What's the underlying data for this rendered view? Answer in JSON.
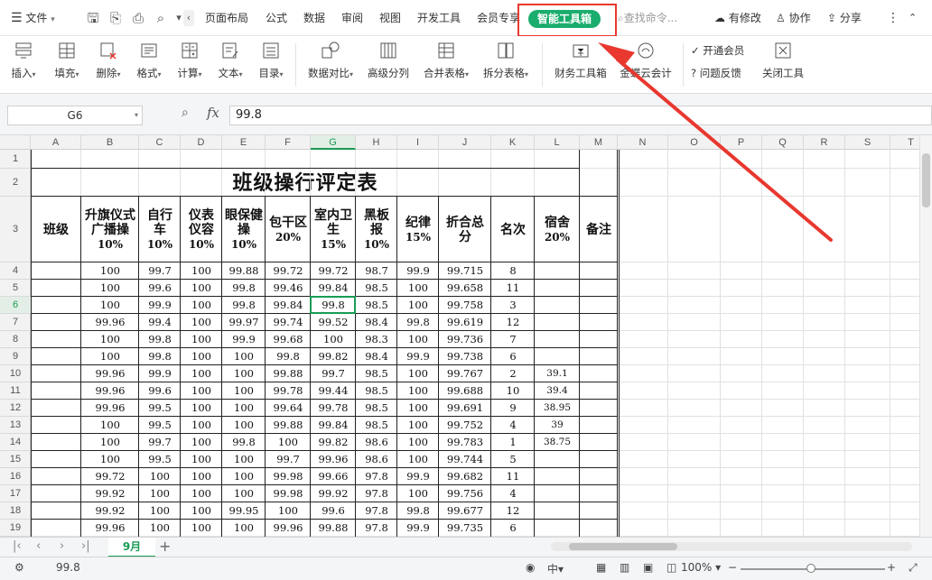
{
  "menubar": {
    "file_label": "文件",
    "tabs": [
      "页面布局",
      "公式",
      "数据",
      "审阅",
      "视图",
      "开发工具",
      "会员专享"
    ],
    "smart_toolbox": "智能工具箱",
    "search_placeholder": "查找命令...",
    "has_changes": "有修改",
    "collab": "协作",
    "share": "分享"
  },
  "ribbon": {
    "insert": "插入",
    "fill": "填充",
    "delete": "删除",
    "format": "格式",
    "calc": "计算",
    "text": "文本",
    "toc": "目录",
    "data_compare": "数据对比",
    "adv_split": "高级分列",
    "merge_tables": "合并表格",
    "split_tables": "拆分表格",
    "finance": "财务工具箱",
    "cloud_accounting": "金蝶云会计",
    "open_member": "开通会员",
    "feedback": "问题反馈",
    "close_tool": "关闭工具"
  },
  "formula_bar": {
    "cell_ref": "G6",
    "fx": "fx",
    "value": "99.8"
  },
  "columns": [
    "A",
    "B",
    "C",
    "D",
    "E",
    "F",
    "G",
    "H",
    "I",
    "J",
    "K",
    "L",
    "M",
    "N",
    "O",
    "P",
    "Q",
    "R",
    "S",
    "T"
  ],
  "rows": [
    "1",
    "2",
    "3",
    "4",
    "5",
    "6",
    "7",
    "8",
    "9",
    "10",
    "11",
    "12",
    "13",
    "14",
    "15",
    "16",
    "17",
    "18",
    "19"
  ],
  "sheet": {
    "title": "班级操行评定表",
    "headers": [
      {
        "text": "班级",
        "pct": ""
      },
      {
        "text": "升旗仪式广播操",
        "pct": "10%"
      },
      {
        "text": "自行车",
        "pct": "10%"
      },
      {
        "text": "仪表仪容",
        "pct": "10%"
      },
      {
        "text": "眼保健操",
        "pct": "10%"
      },
      {
        "text": "包干区",
        "pct": "20%"
      },
      {
        "text": "室内卫生",
        "pct": "15%"
      },
      {
        "text": "黑板报",
        "pct": "10%"
      },
      {
        "text": "纪律",
        "pct": "15%"
      },
      {
        "text": "折合总分",
        "pct": ""
      },
      {
        "text": "名次",
        "pct": ""
      },
      {
        "text": "宿舍",
        "pct": "20%"
      },
      {
        "text": "备注",
        "pct": ""
      }
    ],
    "data_rows": [
      [
        "",
        "100",
        "99.7",
        "100",
        "99.88",
        "99.72",
        "99.72",
        "98.7",
        "99.9",
        "99.715",
        "8",
        "",
        ""
      ],
      [
        "",
        "100",
        "99.6",
        "100",
        "99.8",
        "99.46",
        "99.84",
        "98.5",
        "100",
        "99.658",
        "11",
        "",
        ""
      ],
      [
        "",
        "100",
        "99.9",
        "100",
        "99.8",
        "99.84",
        "99.8",
        "98.5",
        "100",
        "99.758",
        "3",
        "",
        ""
      ],
      [
        "",
        "99.96",
        "99.4",
        "100",
        "99.97",
        "99.74",
        "99.52",
        "98.4",
        "99.8",
        "99.619",
        "12",
        "",
        ""
      ],
      [
        "",
        "100",
        "99.8",
        "100",
        "99.9",
        "99.68",
        "100",
        "98.3",
        "100",
        "99.736",
        "7",
        "",
        ""
      ],
      [
        "",
        "100",
        "99.8",
        "100",
        "100",
        "99.8",
        "99.82",
        "98.4",
        "99.9",
        "99.738",
        "6",
        "",
        ""
      ],
      [
        "",
        "99.96",
        "99.9",
        "100",
        "100",
        "99.88",
        "99.7",
        "98.5",
        "100",
        "99.767",
        "2",
        "39.1",
        ""
      ],
      [
        "",
        "99.96",
        "99.6",
        "100",
        "100",
        "99.78",
        "99.44",
        "98.5",
        "100",
        "99.688",
        "10",
        "39.4",
        ""
      ],
      [
        "",
        "99.96",
        "99.5",
        "100",
        "100",
        "99.64",
        "99.78",
        "98.5",
        "100",
        "99.691",
        "9",
        "38.95",
        ""
      ],
      [
        "",
        "100",
        "99.5",
        "100",
        "100",
        "99.88",
        "99.84",
        "98.5",
        "100",
        "99.752",
        "4",
        "39",
        ""
      ],
      [
        "",
        "100",
        "99.7",
        "100",
        "99.8",
        "100",
        "99.82",
        "98.6",
        "100",
        "99.783",
        "1",
        "38.75",
        ""
      ],
      [
        "",
        "100",
        "99.5",
        "100",
        "100",
        "99.7",
        "99.96",
        "98.6",
        "100",
        "99.744",
        "5",
        "",
        ""
      ],
      [
        "",
        "99.72",
        "100",
        "100",
        "100",
        "99.98",
        "99.66",
        "97.8",
        "99.9",
        "99.682",
        "11",
        "",
        ""
      ],
      [
        "",
        "99.92",
        "100",
        "100",
        "100",
        "99.98",
        "99.92",
        "97.8",
        "100",
        "99.756",
        "4",
        "",
        ""
      ],
      [
        "",
        "99.92",
        "100",
        "100",
        "99.95",
        "100",
        "99.6",
        "97.8",
        "99.8",
        "99.677",
        "12",
        "",
        ""
      ],
      [
        "",
        "99.96",
        "100",
        "100",
        "100",
        "99.96",
        "99.88",
        "97.8",
        "99.9",
        "99.735",
        "6",
        "",
        ""
      ]
    ]
  },
  "sheet_tab": "9月",
  "status": {
    "value": "99.8",
    "zoom": "100%"
  },
  "colors": {
    "accent": "#1aad6d",
    "annotation": "#e8382f"
  }
}
